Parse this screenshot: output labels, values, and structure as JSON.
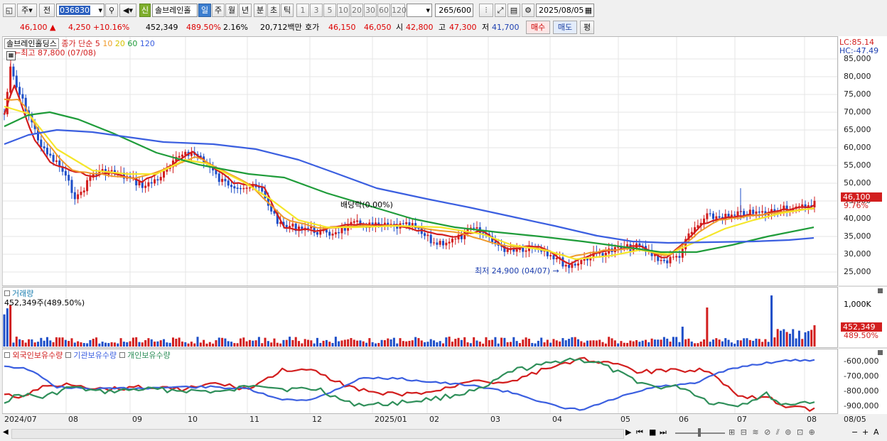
{
  "toolbar": {
    "left_label1": "주",
    "left_label2": "전",
    "code_value": "036830",
    "name_badge": "신",
    "stock_name": "솔브레인홀",
    "periods": [
      "일",
      "주",
      "월",
      "년",
      "분",
      "초",
      "틱"
    ],
    "intervals": [
      "1",
      "3",
      "5",
      "10",
      "20",
      "30",
      "60",
      "120"
    ],
    "count_value": "265",
    "count_total": "/600",
    "date_value": "2025/08/05"
  },
  "quote": {
    "price": "46,100",
    "change_arrow": "▲",
    "change": "4,250",
    "change_pct": "+10.16%",
    "volume": "452,349",
    "volume_ratio": "489.50%",
    "turnover": "2.16%",
    "amount": "20,712백만",
    "hoga_label": "호가",
    "ask": "46,150",
    "bid": "46,050",
    "open_label": "시",
    "open": "42,800",
    "high_label": "고",
    "high": "47,300",
    "low_label": "저",
    "low": "41,700",
    "buy_button": "매수",
    "sell_button": "매도",
    "eval_button": "평"
  },
  "legend": {
    "name": "솔브레인홀딩스",
    "price_label": "종가 단순",
    "ma": [
      "5",
      "10",
      "20",
      "60",
      "120"
    ]
  },
  "annotations": {
    "max_label": "최고 87,800 (07/08)",
    "min_label": "최저 24,900 (04/07)",
    "dividend_label": "배당락(0.00%)",
    "lc_label": "LC:85.14",
    "hc_label": "HC:-47.49",
    "last_price": "46,100",
    "last_pct": "9.76%"
  },
  "volume_panel": {
    "title": "거래량",
    "current": "452,349주(489.50%)",
    "axis": "1,000K",
    "last": "452,349",
    "last_pct": "489.50%"
  },
  "holding_panel": {
    "labels": [
      "외국인보유수량",
      "기관보유수량",
      "개인보유수량"
    ],
    "axis": [
      "-600,000",
      "-700,000",
      "-800,000",
      "-900,000"
    ]
  },
  "price_axis": [
    "85,000",
    "80,000",
    "75,000",
    "70,000",
    "65,000",
    "60,000",
    "55,000",
    "50,000",
    "45,000",
    "40,000",
    "35,000",
    "30,000",
    "25,000"
  ],
  "date_axis": [
    "2024/07",
    "08",
    "09",
    "10",
    "11",
    "12",
    "2025/01",
    "02",
    "03",
    "04",
    "05",
    "06",
    "07",
    "08",
    "08/05"
  ],
  "colors": {
    "up": "#d21e1e",
    "down": "#1e4fc8",
    "ma5": "#d21e1e",
    "ma10": "#f09a2a",
    "ma20": "#f5e62a",
    "ma60": "#1f9c3a",
    "ma120": "#3b5fe0",
    "foreign": "#d21e1e",
    "inst": "#3b5fe0",
    "indiv": "#2f8f5a"
  }
}
